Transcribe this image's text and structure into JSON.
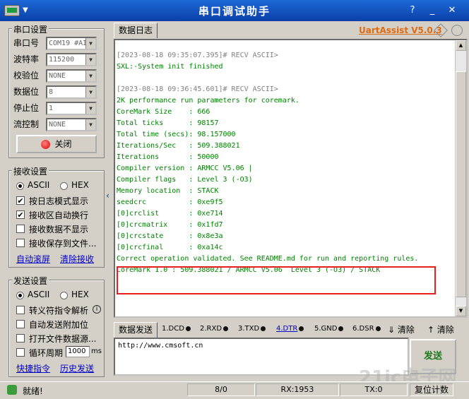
{
  "window": {
    "title": "串口调试助手",
    "menu_glyph": "▼",
    "help_label": "?",
    "minimize_glyph": "_",
    "close_glyph": "✕"
  },
  "serial_settings": {
    "group_title": "串口设置",
    "fields": [
      {
        "label": "串口号",
        "value": "COM19 #AI"
      },
      {
        "label": "波特率",
        "value": "115200"
      },
      {
        "label": "校验位",
        "value": "NONE"
      },
      {
        "label": "数据位",
        "value": "8"
      },
      {
        "label": "停止位",
        "value": "1"
      },
      {
        "label": "流控制",
        "value": "NONE"
      }
    ],
    "close_button_label": "关闭",
    "close_button_icon": "red-led-icon"
  },
  "receive_settings": {
    "group_title": "接收设置",
    "radio_ascii": "ASCII",
    "radio_hex": "HEX",
    "selected": "ASCII",
    "options": [
      {
        "label": "按日志模式显示",
        "checked": true
      },
      {
        "label": "接收区自动换行",
        "checked": true
      },
      {
        "label": "接收数据不显示",
        "checked": false
      },
      {
        "label": "接收保存到文件...",
        "checked": false
      }
    ],
    "link_autoscreen": "自动滚屏",
    "link_clear": "清除接收"
  },
  "send_settings": {
    "group_title": "发送设置",
    "radio_ascii": "ASCII",
    "radio_hex": "HEX",
    "selected": "ASCII",
    "options": [
      {
        "label": "转义符指令解析",
        "checked": false
      },
      {
        "label": "自动发送附加位",
        "checked": false
      },
      {
        "label": "打开文件数据源...",
        "checked": false
      },
      {
        "label": "循环周期",
        "checked": false
      }
    ],
    "cycle_value": "1000",
    "cycle_unit": "ms",
    "link_shortcut": "快捷指令",
    "link_history": "历史发送"
  },
  "log_panel": {
    "tab_label": "数据日志",
    "brand": "UartAssist V5.0.3",
    "lines": [
      {
        "cls": "ts",
        "text": "[2023-08-18 09:35:07.395]# RECV ASCII>"
      },
      {
        "cls": "ok",
        "text": "SXL:-System init finished"
      },
      {
        "cls": "blank",
        "text": " "
      },
      {
        "cls": "ts",
        "text": "[2023-08-18 09:36:45.601]# RECV ASCII>"
      },
      {
        "cls": "ok",
        "text": "2K performance run parameters for coremark."
      },
      {
        "cls": "ok",
        "text": "CoreMark Size    : 666"
      },
      {
        "cls": "ok",
        "text": "Total ticks      : 98157"
      },
      {
        "cls": "ok",
        "text": "Total time (secs): 98.157000"
      },
      {
        "cls": "ok",
        "text": "Iterations/Sec   : 509.388021"
      },
      {
        "cls": "ok",
        "text": "Iterations       : 50000"
      },
      {
        "cls": "ok",
        "text": "Compiler version : ARMCC V5.06 |"
      },
      {
        "cls": "ok",
        "text": "Compiler flags   : Level 3 (-O3)"
      },
      {
        "cls": "ok",
        "text": "Memory location  : STACK"
      },
      {
        "cls": "ok",
        "text": "seedcrc          : 0xe9f5"
      },
      {
        "cls": "ok",
        "text": "[0]crclist       : 0xe714"
      },
      {
        "cls": "ok",
        "text": "[0]crcmatrix     : 0x1fd7"
      },
      {
        "cls": "ok",
        "text": "[0]crcstate      : 0x8e3a"
      },
      {
        "cls": "ok",
        "text": "[0]crcfinal      : 0xa14c"
      },
      {
        "cls": "ok",
        "text": "Correct operation validated. See README.md for run and reporting rules."
      },
      {
        "cls": "ok",
        "text": "CoreMark 1.0 : 509.388021 / ARMCC V5.06  Level 3 (-O3) / STACK"
      }
    ]
  },
  "send_panel": {
    "tab_label": "数据发送",
    "pins": [
      {
        "label": "1.DCD"
      },
      {
        "label": "2.RXD"
      },
      {
        "label": "3.TXD"
      },
      {
        "label": "4.DTR"
      },
      {
        "label": "5.GND"
      },
      {
        "label": "6.DSR"
      }
    ],
    "clear_label_1": "清除",
    "clear_label_2": "清除",
    "input_value": "http://www.cmsoft.cn",
    "send_button": "发送"
  },
  "status": {
    "ready": "就绪!",
    "count": "8/0",
    "rx": "RX:1953",
    "tx": "TX:0",
    "reset": "复位计数"
  },
  "watermark": "21ic电子网"
}
